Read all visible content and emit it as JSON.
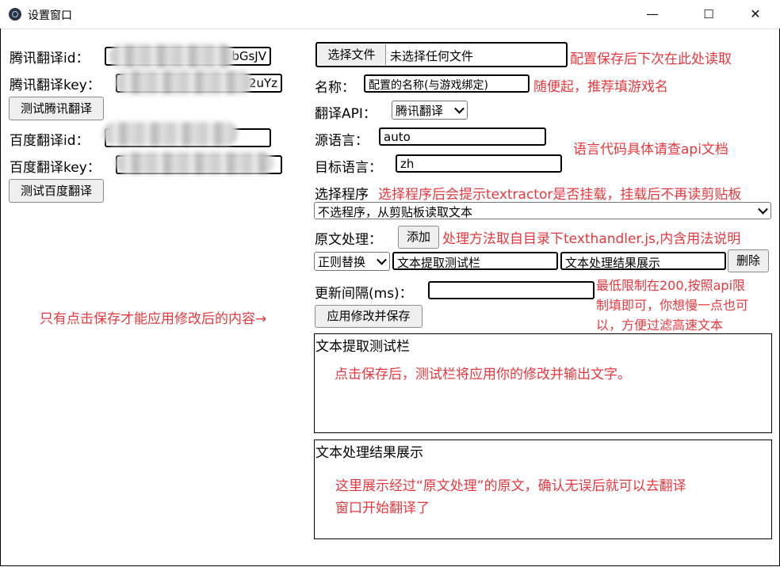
{
  "window": {
    "title": "设置窗口",
    "controls": {
      "minimize": "—",
      "maximize": "☐",
      "close": "✕"
    }
  },
  "left": {
    "tencent_id_label": "腾讯翻译id：",
    "tencent_id_value_tail": "bGsJV",
    "tencent_key_label": "腾讯翻译key：",
    "tencent_key_value_tail": "2uYz",
    "test_tencent_button": "测试腾讯翻译",
    "baidu_id_label": "百度翻译id：",
    "baidu_key_label": "百度翻译key：",
    "test_baidu_button": "测试百度翻译"
  },
  "file": {
    "choose_button": "选择文件",
    "file_status": "未选择任何文件",
    "note": "配置保存后下次在此处读取"
  },
  "name": {
    "label": "名称：",
    "value": "配置的名称(与游戏绑定)",
    "note": "随便起，推荐填游戏名"
  },
  "api": {
    "label": "翻译API：",
    "selected": "腾讯翻译"
  },
  "source_lang": {
    "label": "源语言：",
    "value": "auto"
  },
  "target_lang": {
    "label": "目标语言：",
    "value": "zh"
  },
  "lang_note": "语言代码具体请查api文档",
  "program": {
    "label": "选择程序",
    "note": "选择程序后会提示textractor是否挂载，挂载后不再读剪贴板",
    "selected": "不选程序，从剪贴板读取文本"
  },
  "processing": {
    "label": "原文处理：",
    "add_button": "添加",
    "note": "处理方法取自目录下texthandler.js,内含用法说明",
    "method_selected": "正则替换",
    "field1": "文本提取测试栏",
    "field2": "文本处理结果展示",
    "delete_button": "删除"
  },
  "interval": {
    "label": "更新间隔(ms)：",
    "value": "",
    "note_lines": [
      "最低限制在200,按照api限",
      "制填即可，你想慢一点也可",
      "以，方便过滤高速文本"
    ]
  },
  "save": {
    "note": "只有点击保存才能应用修改后的内容→",
    "button": "应用修改并保存"
  },
  "test_area": {
    "title": "文本提取测试栏",
    "note": "点击保存后，测试栏将应用你的修改并输出文字。"
  },
  "result_area": {
    "title": "文本处理结果展示",
    "note_lines": [
      "这里展示经过“原文处理”的原文，确认无误后就可以去翻译",
      "窗口开始翻译了"
    ]
  },
  "colors": {
    "annotation": "#e8383d"
  }
}
